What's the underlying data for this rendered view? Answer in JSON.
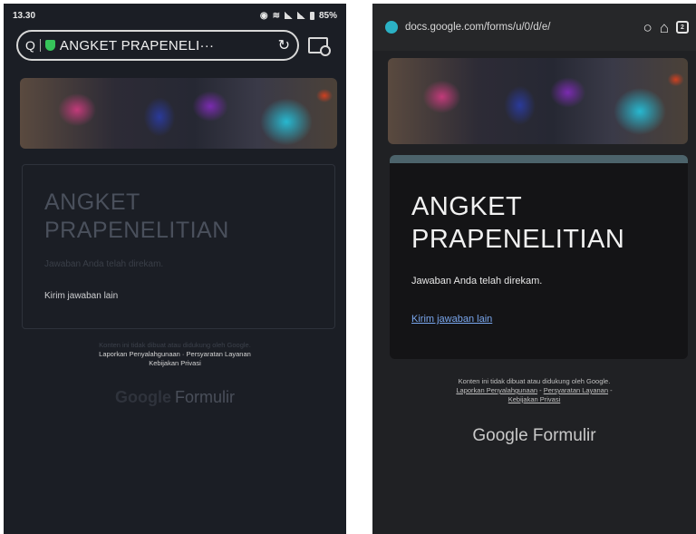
{
  "left": {
    "status": {
      "time": "13.30",
      "battery": "85%"
    },
    "addressbar": {
      "search_symbol": "Q",
      "title": "ANGKET PRAPENELI···"
    },
    "card": {
      "title_line1": "ANGKET",
      "title_line2": "PRAPENELITIAN",
      "confirmation": "Jawaban Anda telah direkam.",
      "submit_another": "Kirim jawaban lain"
    },
    "footer": {
      "disclaimer": "Konten ini tidak dibuat atau didukung oleh Google.",
      "link_abuse": "Laporkan Penyalahgunaan",
      "link_terms": "Persyaratan Layanan",
      "link_privacy": "Kebijakan Privasi",
      "brand_google": "Google",
      "brand_forms": "Formulir"
    }
  },
  "right": {
    "browser": {
      "url": "docs.google.com/forms/u/0/d/e/",
      "tab_count": "2"
    },
    "card": {
      "title_line1": "ANGKET",
      "title_line2": "PRAPENELITIAN",
      "confirmation": "Jawaban Anda telah direkam.",
      "submit_another": "Kirim jawaban lain"
    },
    "footer": {
      "disclaimer": "Konten ini tidak dibuat atau didukung oleh Google.",
      "link_abuse": "Laporkan Penyalahgunaan",
      "link_terms": "Persyaratan Layanan",
      "link_privacy": "Kebijakan Privasi",
      "brand": "Google Formulir"
    }
  },
  "colors": {
    "left_bg": "#1b1e25",
    "right_bg": "#202124",
    "link_blue": "#7aa7ee",
    "card_accent": "#4c636b"
  }
}
